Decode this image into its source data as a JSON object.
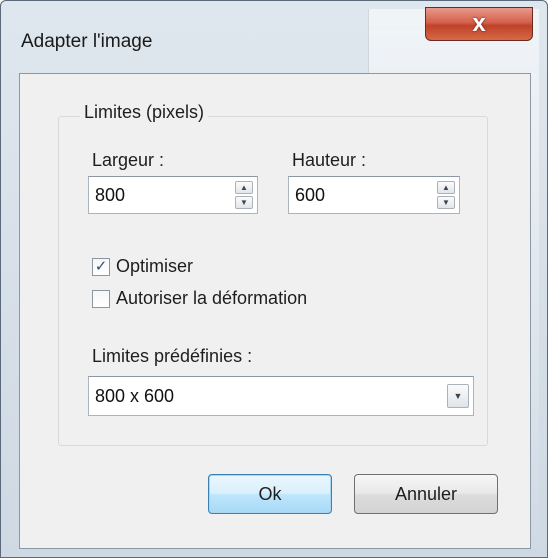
{
  "window": {
    "title": "Adapter l'image",
    "close_glyph": "x"
  },
  "limits": {
    "group_title": "Limites (pixels)",
    "width_label": "Largeur :",
    "width_value": "800",
    "height_label": "Hauteur :",
    "height_value": "600"
  },
  "options": {
    "optimize_label": "Optimiser",
    "optimize_checked": true,
    "allow_deform_label": "Autoriser la déformation",
    "allow_deform_checked": false
  },
  "presets": {
    "label": "Limites prédéfinies :",
    "selected": "800 x 600"
  },
  "buttons": {
    "ok": "Ok",
    "cancel": "Annuler"
  },
  "icons": {
    "check": "check-icon",
    "spin_up": "spin-up-icon",
    "spin_down": "spin-down-icon",
    "dropdown": "chevron-down-icon",
    "close": "close-icon"
  }
}
